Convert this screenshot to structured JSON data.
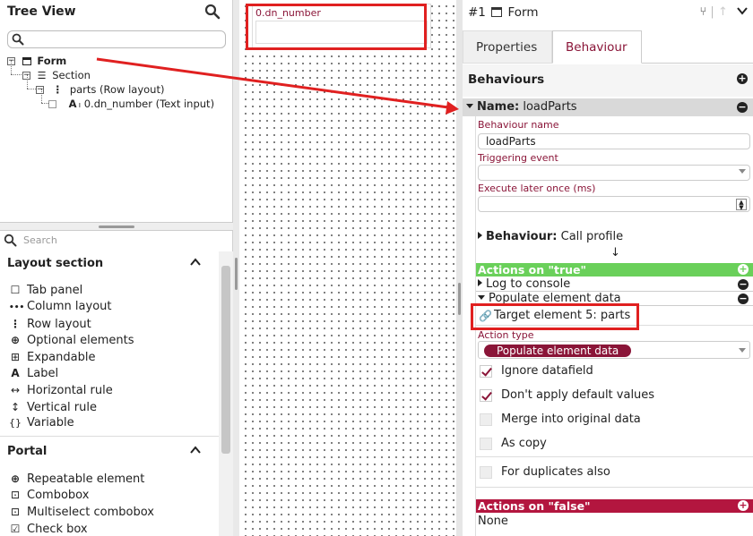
{
  "tree_view": {
    "title": "Tree View",
    "items": [
      {
        "label": "Form",
        "type": "form"
      },
      {
        "label": "Section",
        "type": "section"
      },
      {
        "label": "parts (Row layout)",
        "type": "row"
      },
      {
        "label": "0.dn_number (Text input)",
        "type": "text"
      }
    ]
  },
  "palette": {
    "search_placeholder": "Search",
    "layout_section": {
      "title": "Layout section",
      "items": [
        {
          "label": "Tab panel",
          "icon": "tab-panel-icon",
          "glyph": "☐"
        },
        {
          "label": "Column layout",
          "icon": "column-layout-icon",
          "glyph": "•••"
        },
        {
          "label": "Row layout",
          "icon": "row-layout-icon",
          "glyph": "⋮"
        },
        {
          "label": "Optional elements",
          "icon": "plus-circle-icon",
          "glyph": "⊕"
        },
        {
          "label": "Expandable",
          "icon": "expand-icon",
          "glyph": "⊞"
        },
        {
          "label": "Label",
          "icon": "label-icon",
          "glyph": "A"
        },
        {
          "label": "Horizontal rule",
          "icon": "horizontal-rule-icon",
          "glyph": "↔"
        },
        {
          "label": "Vertical rule",
          "icon": "vertical-rule-icon",
          "glyph": "↕"
        },
        {
          "label": "Variable",
          "icon": "variable-icon",
          "glyph": "{}"
        }
      ]
    },
    "portal": {
      "title": "Portal",
      "items": [
        {
          "label": "Repeatable element",
          "icon": "repeatable-icon",
          "glyph": "⊕"
        },
        {
          "label": "Combobox",
          "icon": "combobox-icon",
          "glyph": "⊡"
        },
        {
          "label": "Multiselect combobox",
          "icon": "multiselect-icon",
          "glyph": "⊡"
        },
        {
          "label": "Check box",
          "icon": "checkbox-icon",
          "glyph": "☑"
        }
      ]
    }
  },
  "canvas": {
    "field_label": "0.dn_number"
  },
  "right_panel": {
    "title_prefix": "#1",
    "title": "Form",
    "tabs": [
      "Properties",
      "Behaviour"
    ],
    "behaviours_title": "Behaviours",
    "name_prefix": "Name:",
    "name_value": "loadParts",
    "behaviour_name_label": "Behaviour name",
    "behaviour_name_value": "loadParts",
    "triggering_event_label": "Triggering event",
    "execute_later_label": "Execute later once (ms)",
    "behaviour_prefix": "Behaviour:",
    "behaviour_value": "Call profile",
    "down_arrow": "↓",
    "actions_true": "Actions on \"true\"",
    "action_log": "Log to console",
    "action_populate": "Populate element data",
    "target_element": "Target element 5: parts",
    "action_type_label": "Action type",
    "action_type_value": "Populate element data",
    "checkboxes": [
      {
        "label": "Ignore datafield",
        "checked": true
      },
      {
        "label": "Don't apply default values",
        "checked": true
      },
      {
        "label": "Merge into original data",
        "checked": false
      },
      {
        "label": "As copy",
        "checked": false
      },
      {
        "label": "For duplicates also",
        "checked": false
      }
    ],
    "actions_false": "Actions on \"false\"",
    "none_text": "None"
  },
  "colors": {
    "accent": "#8a1538",
    "true_bar": "#6ad05a",
    "false_bar": "#b3163f",
    "annotation": "#e02020"
  }
}
